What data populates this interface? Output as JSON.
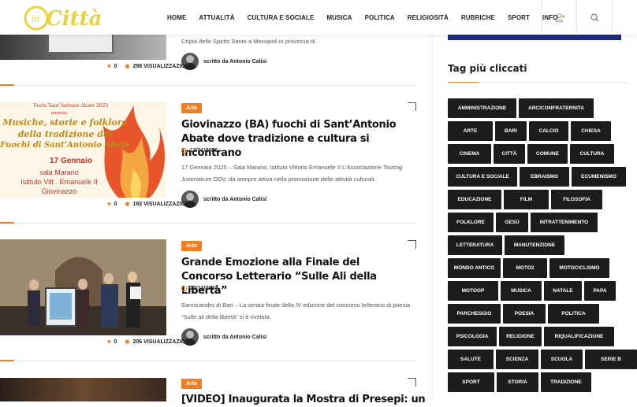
{
  "brand": {
    "logo_text": "Città",
    "logo_prefix": "in"
  },
  "nav": {
    "items": [
      "HOME",
      "ATTUALITÀ",
      "CULTURA E SOCIALE",
      "MUSICA",
      "POLITICA",
      "RELIGIOSITÀ",
      "RUBRICHE",
      "SPORT"
    ],
    "info": "INFO"
  },
  "icons": {
    "user": "user-icon",
    "search": "search-icon",
    "caret": "caret-down-icon"
  },
  "colors": {
    "accent": "#f07f22",
    "tag_bg": "#1c1c1c",
    "blue": "#1f2a7a"
  },
  "articles": [
    {
      "excerpt": "Cripta dello Spirito Santo a Monopoli in provincia di.",
      "author": "scritto da Antonio Calisi",
      "comments": "0",
      "views": "298 VISUALIZZAZIONI"
    },
    {
      "category": "Arte",
      "title": "Giovinazzo (BA) fuochi di Sant’Antonio Abate dove tradizione e cultura si incontrano",
      "date": "13/01/2025",
      "excerpt": "17 Gennaio 2025 – Sala Marano, Istituto Vittorio Emanuele II L’Associazione Touring Juvenatium ODV, da sempre attiva nella promozione delle attività culturali.",
      "author": "scritto da Antonio Calisi",
      "comments": "0",
      "views": "192 VISUALIZZAZIONI",
      "poster": {
        "header": "Festa Sant’Antonio Abate 2025",
        "presenta": "presenta",
        "line1": "Musiche, storie e folklore",
        "line2": "della tradizione dei",
        "line3": "Fuochi di Sant’Antonio Abate",
        "date": "17 Gennaio",
        "place1": "sala Marano",
        "place2": "Istituto Vitt . Emanuele II",
        "place3": "Giovinazzo"
      }
    },
    {
      "category": "Arte",
      "title": "Grande Emozione alla Finale del Concorso Letterario “Sulle Ali della Libertà”",
      "date": "23/12/2024",
      "excerpt": "Sannicandro di Bari – La serata finale della IV edizione del concorso letterario di poesia “Sulle ali della libertà” si è rivelata.",
      "author": "scritto da Antonio Calisi",
      "comments": "0",
      "views": "206 VISUALIZZAZIONI"
    },
    {
      "category": "Arte",
      "title": "[VIDEO] Inaugurata la Mostra di Presepi: un"
    }
  ],
  "sidebar": {
    "heading": "Tag più cliccati",
    "tags": [
      "AMMINISTRAZIONE",
      "ARCICONFRATERNITA",
      "ARTE",
      "BARI",
      "CALCIO",
      "CHIESA",
      "CINEMA",
      "CITTÀ",
      "COMUNE",
      "CULTURA",
      "CULTURA E SOCIALE",
      "EBRAISMO",
      "ECUMENISMO",
      "EDUCAZIONE",
      "FILM",
      "FILOSOFIA",
      "FOLKLORE",
      "GESÙ",
      "INTRATTENIMENTO",
      "LETTERATURA",
      "MANUTENZIONE",
      "MONDO ANTICO",
      "MOTO2",
      "MOTOCICLISMO",
      "MOTOGP",
      "MUSICA",
      "NATALE",
      "PAPA",
      "PARCHEGGIO",
      "POESIA",
      "POLITICA",
      "PSICOLOGIA",
      "RELIGIONE",
      "RIQUALIFICAZIONE",
      "SALUTE",
      "SCIENZA",
      "SCUOLA",
      "SERIE B",
      "SPORT",
      "STORIA",
      "TRADIZIONE"
    ]
  }
}
